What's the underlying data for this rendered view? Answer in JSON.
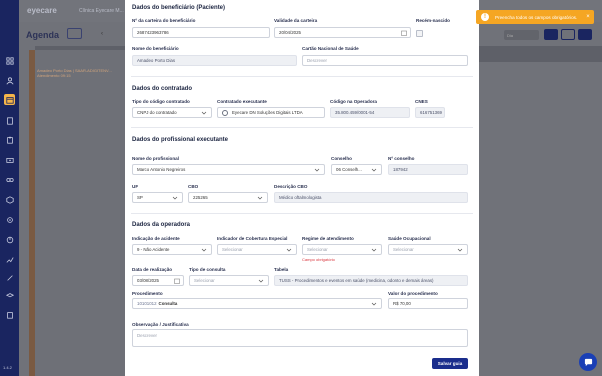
{
  "app": {
    "brand": "eyecare",
    "unit_tab": "Clínica Eyecare M...",
    "version": "1.4.2"
  },
  "background": {
    "page_title": "Agenda",
    "event_text": "Amadeo Porto Dias | SAAR-ADIGITENV... Atendimento 09:15",
    "view_select": "Dia"
  },
  "colors": {
    "nav_bg": "#1a2560",
    "nav_active": "#f5b54a",
    "primary_button": "#1a2d8c",
    "toast": "#f5a623",
    "error": "#d9363e"
  },
  "nav_icons": [
    "home-icon",
    "users-icon",
    "calendar-icon",
    "document-icon",
    "clipboard-icon",
    "money-icon",
    "glasses-icon",
    "box-icon",
    "settings-icon",
    "chart-icon",
    "pen-icon",
    "graduation-icon",
    "building-icon"
  ],
  "toast": {
    "message": "Preencha todos os campos obrigatórios.",
    "close": "×"
  },
  "form": {
    "beneficiario": {
      "title": "Dados do beneficiário (Paciente)",
      "carteira_label": "Nº da carteira do beneficiário",
      "carteira_value": "2687423963786",
      "validade_label": "Validade da carteira",
      "validade_value": "20/04/2025",
      "recem_nascido_label": "Recém-nascido",
      "nome_label": "Nome do beneficiário",
      "nome_value": "Amadeo Porto Dias",
      "cns_label": "Cartão Nacional de Saúde",
      "cns_placeholder": "Descrever"
    },
    "contratado": {
      "title": "Dados do contratado",
      "tipo_codigo_label": "Tipo do código contratado",
      "tipo_codigo_value": "CNPJ do contratado",
      "executante_label": "Contratado executante",
      "executante_value": "Eyecare DN Soluções Digitais LTDA",
      "codigo_operadora_label": "Código na Operadora",
      "codigo_operadora_value": "35.800.459/0001-54",
      "cnes_label": "CNES",
      "cnes_value": "616751369"
    },
    "profissional": {
      "title": "Dados do profissional executante",
      "nome_label": "Nome do profissional",
      "nome_value": "Marco Antonio Negreiros",
      "conselho_label": "Conselho",
      "conselho_value": "06 Conselh...",
      "num_conselho_label": "Nº conselho",
      "num_conselho_value": "187942",
      "uf_label": "UF",
      "uf_value": "SP",
      "cbo_label": "CBO",
      "cbo_value": "225265",
      "desc_cbo_label": "Descrição CBO",
      "desc_cbo_value": "Médico oftalmologista"
    },
    "operadora": {
      "title": "Dados da operadora",
      "indicacao_label": "Indicação de acidente",
      "indicacao_value": "9 - Não Acidente",
      "cobertura_label": "Indicador de Cobertura Especial",
      "cobertura_placeholder": "Selecionar",
      "regime_label": "Regime de atendimento",
      "regime_placeholder": "Selecionar",
      "regime_error": "Campo obrigatório",
      "saude_ocup_label": "Saúde Ocupacional",
      "saude_ocup_placeholder": "Selecionar",
      "data_label": "Data de realização",
      "data_value": "03/08/2025",
      "tipo_consulta_label": "Tipo de consulta",
      "tipo_consulta_placeholder": "Selecionar",
      "tabela_label": "Tabela",
      "tabela_value": "TUSS - Procedimentos e eventos em saúde (medicina, odonto e demais áreas)",
      "procedimento_label": "Procedimento",
      "procedimento_code": "10101012",
      "procedimento_name": "Consulta",
      "valor_label": "Valor do procedimento",
      "valor_value": "R$ 70,00",
      "obs_label": "Observação / Justificativa",
      "obs_placeholder": "Descrever"
    },
    "save_label": "Salvar guia"
  }
}
